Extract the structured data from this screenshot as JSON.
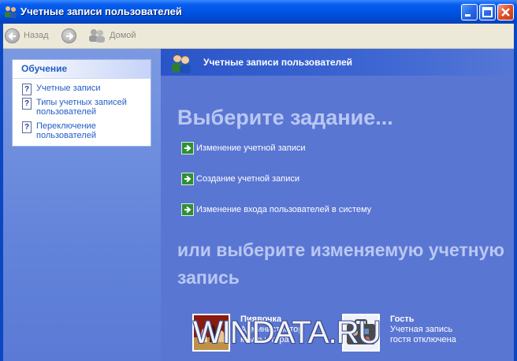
{
  "window": {
    "title": "Учетные записи пользователей"
  },
  "toolbar": {
    "back_label": "Назад",
    "home_label": "Домой"
  },
  "learn": {
    "heading": "Обучение",
    "items": [
      {
        "label": "Учетные записи"
      },
      {
        "label": "Типы учетных записей пользователей"
      },
      {
        "label": "Переключение пользователей"
      }
    ]
  },
  "main": {
    "header_title": "Учетные записи пользователей",
    "task_title": "Выберите задание...",
    "tasks": [
      {
        "label": "Изменение учетной записи"
      },
      {
        "label": "Создание учетной записи"
      },
      {
        "label": "Изменение входа пользователей в систему"
      }
    ],
    "pick_title": "или выберите изменяемую учетную запись",
    "accounts": [
      {
        "name": "Пиявочка",
        "desc": "Администратор компьютера"
      },
      {
        "name": "Гость",
        "desc": "Учетная запись гостя отключена"
      }
    ]
  },
  "watermark": "WINDATA.RU",
  "colors": {
    "pane_blue": "#5a76d3",
    "title_blue": "#0054e3",
    "link_blue": "#215dc6",
    "arrow_green": "#2f8f38"
  }
}
